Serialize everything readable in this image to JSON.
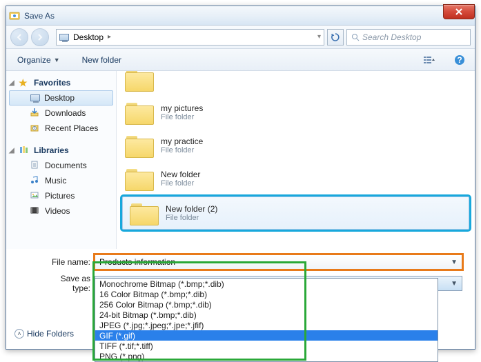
{
  "window": {
    "title": "Save As"
  },
  "nav": {
    "location_icon_name": "desktop",
    "location": "Desktop",
    "crumb_sep": "▸",
    "search_placeholder": "Search Desktop"
  },
  "toolbar": {
    "organize": "Organize",
    "newfolder": "New folder"
  },
  "sidebar": {
    "favorites": {
      "label": "Favorites",
      "items": [
        {
          "label": "Desktop",
          "icon": "desktop",
          "selected": true
        },
        {
          "label": "Downloads",
          "icon": "downloads"
        },
        {
          "label": "Recent Places",
          "icon": "recent"
        }
      ]
    },
    "libraries": {
      "label": "Libraries",
      "items": [
        {
          "label": "Documents",
          "icon": "documents"
        },
        {
          "label": "Music",
          "icon": "music"
        },
        {
          "label": "Pictures",
          "icon": "pictures"
        },
        {
          "label": "Videos",
          "icon": "videos"
        }
      ]
    }
  },
  "content": {
    "type_label": "File folder",
    "items": [
      {
        "name": "my pictures"
      },
      {
        "name": "my practice"
      },
      {
        "name": "New folder"
      },
      {
        "name": "New folder (2)",
        "highlighted": true
      }
    ]
  },
  "fields": {
    "filename_label": "File name:",
    "filename_value": "Products information",
    "savetype_label": "Save as type:",
    "savetype_value": "GIF (*.gif)",
    "options": [
      "Monochrome Bitmap (*.bmp;*.dib)",
      "16 Color Bitmap (*.bmp;*.dib)",
      "256 Color Bitmap (*.bmp;*.dib)",
      "24-bit Bitmap (*.bmp;*.dib)",
      "JPEG (*.jpg;*.jpeg;*.jpe;*.jfif)",
      "GIF (*.gif)",
      "TIFF (*.tif;*.tiff)",
      "PNG (*.png)"
    ],
    "selected_index": 5
  },
  "footer": {
    "hidefolders": "Hide Folders"
  }
}
